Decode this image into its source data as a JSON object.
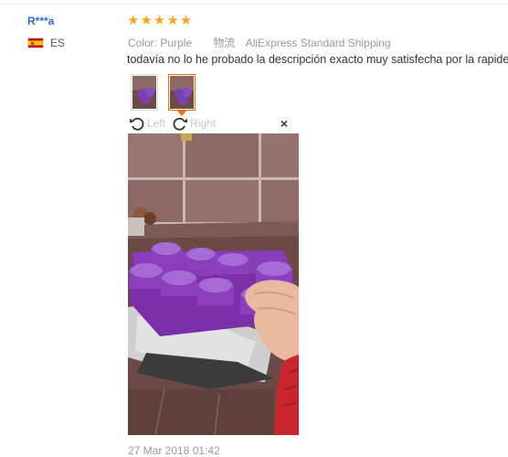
{
  "buyer": {
    "name": "R***a",
    "country_code": "ES",
    "flag_icon": "spain-flag-icon"
  },
  "review": {
    "rating": 5,
    "star_color": "#f5a623",
    "color_label": "Color:",
    "color_value": "Purple",
    "shipping_label": "物流",
    "shipping_value": "AliExpress Standard Shipping",
    "text": "todavía no lo he probado la descripción exacto muy satisfecha por la rapidez d",
    "thumbnails": [
      {
        "name": "review-photo-thumb-1",
        "active": false
      },
      {
        "name": "review-photo-thumb-2",
        "active": true
      }
    ],
    "active_thumb_color": "#ff6a00",
    "viewer": {
      "rotate_left_label": "Left",
      "rotate_right_label": "Right",
      "close_icon": "close-icon"
    },
    "date": "27 Mar 2018 01:42"
  },
  "colors": {
    "buyer_name": "#3366cc",
    "muted_text": "#999999",
    "body_text": "#333333"
  }
}
